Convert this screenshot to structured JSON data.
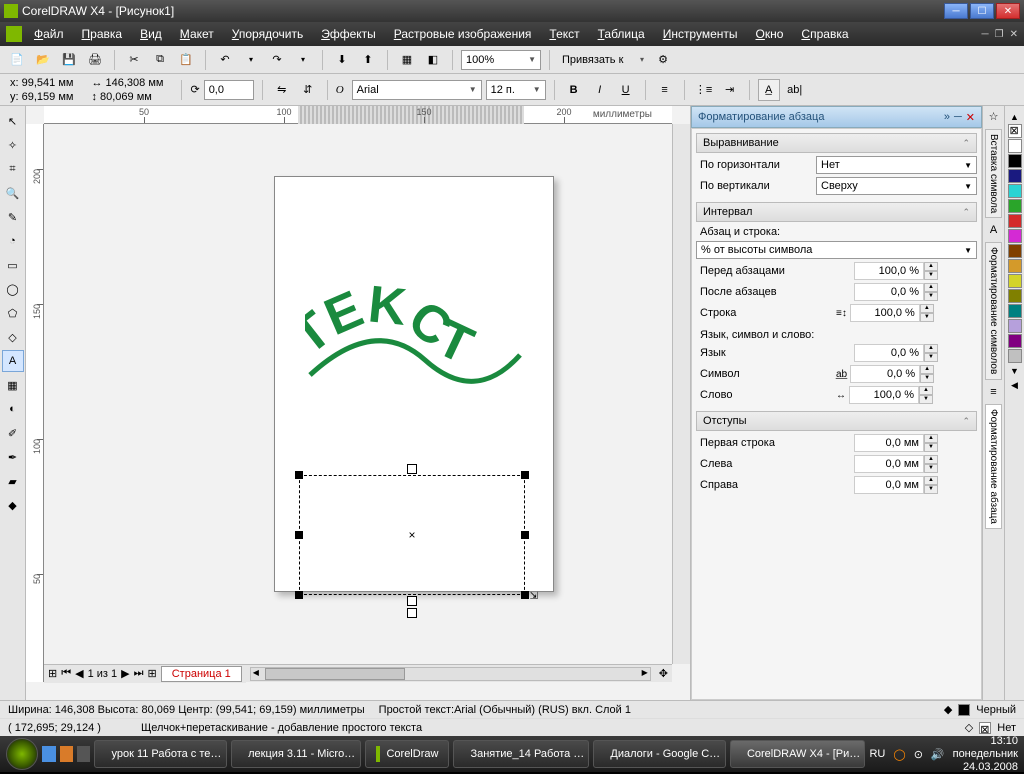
{
  "title": "CorelDRAW X4 - [Рисунок1]",
  "menu": [
    "Файл",
    "Правка",
    "Вид",
    "Макет",
    "Упорядочить",
    "Эффекты",
    "Растровые изображения",
    "Текст",
    "Таблица",
    "Инструменты",
    "Окно",
    "Справка"
  ],
  "toolbar1": {
    "zoom": "100%",
    "snap": "Привязать к"
  },
  "property_bar": {
    "x_label": "x:",
    "x": "99,541 мм",
    "y_label": "y:",
    "y": "69,159 мм",
    "w": "146,308 мм",
    "h": "80,069 мм",
    "rotate": "0,0",
    "font": "Arial",
    "size": "12 п."
  },
  "ruler_units": "миллиметры",
  "canvas_text": "TEKCT",
  "page_nav": {
    "counter": "1 из 1",
    "tab": "Страница 1"
  },
  "docker": {
    "title": "Форматирование абзаца",
    "align_section": "Выравнивание",
    "halign_label": "По горизонтали",
    "halign_value": "Нет",
    "valign_label": "По вертикали",
    "valign_value": "Сверху",
    "interval_section": "Интервал",
    "para_line_label": "Абзац и строка:",
    "unit_combo": "% от высоты символа",
    "before_label": "Перед абзацами",
    "before_val": "100,0 %",
    "after_label": "После абзацев",
    "after_val": "0,0 %",
    "line_label": "Строка",
    "line_val": "100,0 %",
    "lang_section": "Язык, символ и слово:",
    "lang_label": "Язык",
    "lang_val": "0,0 %",
    "char_label": "Символ",
    "char_val": "0,0 %",
    "word_label": "Слово",
    "word_val": "100,0 %",
    "indent_section": "Отступы",
    "first_label": "Первая строка",
    "first_val": "0,0 мм",
    "left_label": "Слева",
    "left_val": "0,0 мм",
    "right_label": "Справа",
    "right_val": "0,0 мм"
  },
  "vtabs": [
    "Вставка символа",
    "Форматирование символов",
    "Форматирование абзаца"
  ],
  "status1": {
    "dims": "Ширина: 146,308 Высота: 80,069 Центр: (99,541; 69,159) миллиметры",
    "info": "Простой текст:Arial (Обычный) (RUS) вкл. Слой 1",
    "color_fill": "Черный",
    "color_outline": "Нет"
  },
  "status2": {
    "coords": "( 172,695; 29,124 )",
    "hint": "Щелчок+перетаскивание - добавление простого текста"
  },
  "taskbar": {
    "tasks": [
      "урок 11 Работа с те…",
      "лекция 3.11 - Micro…",
      "CorelDraw",
      "Занятие_14 Работа …",
      "Диалоги - Google С…",
      "CorelDRAW X4 - [Ри…"
    ],
    "lang": "RU",
    "time": "13:10",
    "day": "понедельник",
    "date": "24.03.2008"
  },
  "ruler_h": [
    50,
    100,
    150,
    200
  ],
  "ruler_v": [
    50,
    100,
    150,
    200
  ],
  "palette": [
    "#ffffff",
    "#000000",
    "#1a1a80",
    "#2ad4d4",
    "#2aa52a",
    "#d42a2a",
    "#d42ad4",
    "#804000",
    "#d49a2a",
    "#d4d42a",
    "#808000",
    "#008080",
    "#b6a0dc",
    "#800080",
    "#c0c0c0"
  ]
}
